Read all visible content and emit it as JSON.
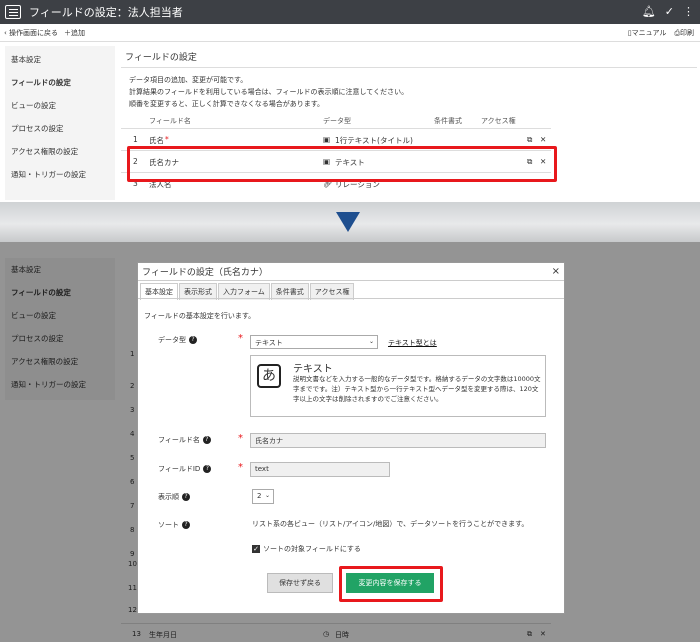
{
  "header": {
    "title": "フィールドの設定：法人担当者"
  },
  "toolbar": {
    "back_label": "操作画面に戻る",
    "add_label": "追加",
    "manual_label": "マニュアル",
    "print_label": "印刷"
  },
  "sidebar": {
    "items": [
      "基本設定",
      "フィールドの設定",
      "ビューの設定",
      "プロセスの設定",
      "アクセス権限の設定",
      "通知・トリガーの設定"
    ]
  },
  "content": {
    "title": "フィールドの設定",
    "description": [
      "データ項目の追加、変更が可能です。",
      "計算結果のフィールドを利用している場合は、フィールドの表示順に注意してください。",
      "順番を変更すると、正しく計算できなくなる場合があります。"
    ],
    "columns": {
      "name": "フィールド名",
      "type": "データ型",
      "condition": "条件書式",
      "access": "アクセス権"
    },
    "rows": [
      {
        "num": "1",
        "name": "氏名",
        "required": "*",
        "type": "1行テキスト(タイトル)"
      },
      {
        "num": "2",
        "name": "氏名カナ",
        "type": "テキスト"
      },
      {
        "num": "3",
        "name": "法人名",
        "type": "リレーション"
      }
    ],
    "bottom_rows": [
      {
        "num": "13",
        "name": "生年月日",
        "type": "日時"
      }
    ],
    "row_numbers_faded": [
      "1",
      "2",
      "3",
      "4",
      "5",
      "6",
      "7",
      "8",
      "9",
      "10",
      "11",
      "12"
    ]
  },
  "modal": {
    "title": "フィールドの設定（氏名カナ）",
    "close": "×",
    "tabs": [
      "基本設定",
      "表示形式",
      "入力フォーム",
      "条件書式",
      "アクセス権"
    ],
    "intro": "フィールドの基本設定を行います。",
    "data_type_label": "データ型",
    "data_type_value": "テキスト",
    "data_type_link": "テキスト型とは",
    "info_title": "テキスト",
    "info_icon": "あ",
    "info_text": "説明文書などを入力する一般的なデータ型です。格納するデータの文字数は10000文字までです。注）テキスト型から一行テキスト型へデータ型を変更する際は、120文字以上の文字は削除されますのでご注意ください。",
    "field_name_label": "フィールド名",
    "field_name_value": "氏名カナ",
    "field_id_label": "フィールドID",
    "field_id_value": "text",
    "order_label": "表示順",
    "order_value": "2",
    "sort_label": "ソート",
    "sort_text": "リスト系の各ビュー（リスト/アイコン/地図）で、データソートを行うことができます。",
    "sort_checkbox_label": "ソートの対象フィールドにする",
    "cancel_button": "保存せず戻る",
    "save_button": "変更内容を保存する",
    "required_mark": "*"
  },
  "colors": {
    "topbar": "#3d4045",
    "highlight": "#e8181c",
    "save": "#21a365",
    "arrow": "#1f4f8f"
  }
}
